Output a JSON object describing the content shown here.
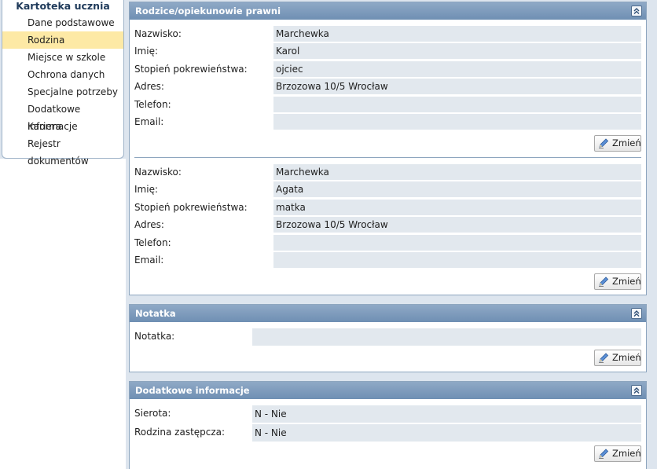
{
  "sidebar": {
    "title": "Kartoteka ucznia",
    "items": [
      {
        "label": "Dane podstawowe"
      },
      {
        "label": "Rodzina"
      },
      {
        "label": "Miejsce w szkole"
      },
      {
        "label": "Ochrona danych"
      },
      {
        "label": "Specjalne potrzeby"
      },
      {
        "label": "Dodatkowe informacje"
      },
      {
        "label": "Kariera"
      },
      {
        "label": "Rejestr dokumentów"
      }
    ],
    "active_item": "Rodzina"
  },
  "parents_panel": {
    "title": "Rodzice/opiekunowie prawni",
    "collapse_icon": "double-chevron-up-icon",
    "guardians": [
      {
        "fields": [
          {
            "label": "Nazwisko:",
            "value": "Marchewka"
          },
          {
            "label": "Imię:",
            "value": "Karol"
          },
          {
            "label": "Stopień pokrewieństwa:",
            "value": "ojciec"
          },
          {
            "label": "Adres:",
            "value": "Brzozowa 10/5 Wrocław"
          },
          {
            "label": "Telefon:",
            "value": ""
          },
          {
            "label": "Email:",
            "value": ""
          }
        ],
        "edit_label": "Zmień"
      },
      {
        "fields": [
          {
            "label": "Nazwisko:",
            "value": "Marchewka"
          },
          {
            "label": "Imię:",
            "value": "Agata"
          },
          {
            "label": "Stopień pokrewieństwa:",
            "value": "matka"
          },
          {
            "label": "Adres:",
            "value": "Brzozowa 10/5 Wrocław"
          },
          {
            "label": "Telefon:",
            "value": ""
          },
          {
            "label": "Email:",
            "value": ""
          }
        ],
        "edit_label": "Zmień"
      }
    ]
  },
  "note_panel": {
    "title": "Notatka",
    "fields": [
      {
        "label": "Notatka:",
        "value": ""
      }
    ],
    "edit_label": "Zmień"
  },
  "extra_panel": {
    "title": "Dodatkowe informacje",
    "fields": [
      {
        "label": "Sierota:",
        "value": "N - Nie"
      },
      {
        "label": "Rodzina zastępcza:",
        "value": "N - Nie"
      }
    ],
    "edit_label": "Zmień"
  },
  "colors": {
    "header_bg": "#7f9cbf",
    "active_item_bg": "#fde9a5",
    "value_bg": "#e2e8ee"
  }
}
